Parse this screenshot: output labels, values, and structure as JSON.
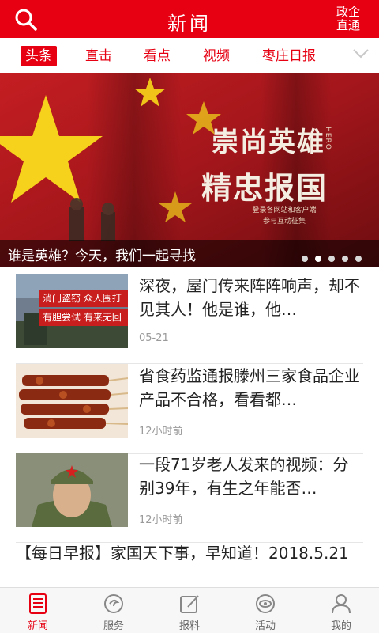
{
  "header": {
    "title": "新闻",
    "right_line1": "政企",
    "right_line2": "直通",
    "search_icon": "search-icon",
    "color": "#e60012"
  },
  "tabs": [
    {
      "label": "头条",
      "active": true
    },
    {
      "label": "直击",
      "active": false
    },
    {
      "label": "看点",
      "active": false
    },
    {
      "label": "视频",
      "active": false
    },
    {
      "label": "枣庄日报",
      "active": false
    }
  ],
  "banner": {
    "title_line1": "崇尚英雄",
    "title_line2": "精忠报国",
    "hero_tag": "HERO",
    "subtext_line1": "登录各网站和客户端",
    "subtext_line2": "参与互动征集",
    "caption": "谁是英雄？今天，我们一起寻找",
    "slide_count": 5,
    "active_slide": 1
  },
  "news": [
    {
      "headline": "深夜，屋门传来阵阵响声，却不见其人！他是谁，他…",
      "time": "05-21",
      "thumb_banner1": "消门盗窃 众人围打",
      "thumb_banner2": "有胆尝试 有来无回"
    },
    {
      "headline": "省食药监通报滕州三家食品企业产品不合格，看看都…",
      "time": "12小时前"
    },
    {
      "headline": "一段71岁老人发来的视频：分别39年，有生之年能否…",
      "time": "12小时前"
    }
  ],
  "morning_report": "【每日早报】家国天下事，早知道！2018.5.21",
  "bottom_nav": [
    {
      "label": "新闻",
      "icon": "news-icon",
      "active": true
    },
    {
      "label": "服务",
      "icon": "service-icon",
      "active": false
    },
    {
      "label": "报料",
      "icon": "report-icon",
      "active": false
    },
    {
      "label": "活动",
      "icon": "activity-icon",
      "active": false
    },
    {
      "label": "我的",
      "icon": "profile-icon",
      "active": false
    }
  ]
}
